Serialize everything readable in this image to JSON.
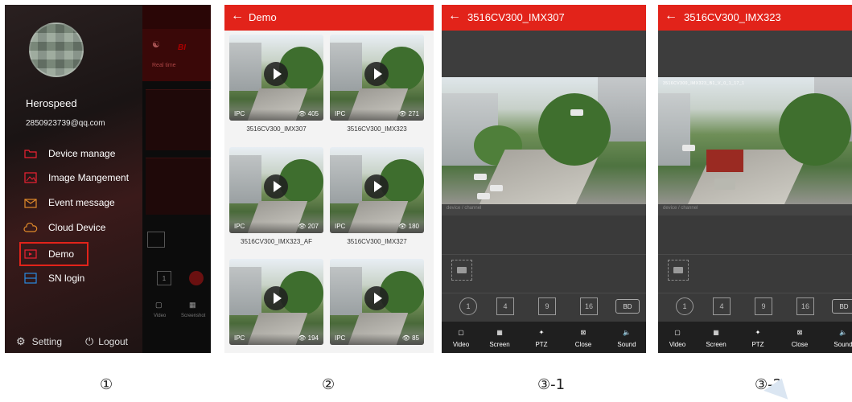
{
  "panel1": {
    "user_name": "Herospeed",
    "email": "2850923739@qq.com",
    "menu": [
      {
        "label": "Device manage",
        "icon": "folder-icon",
        "selected": false
      },
      {
        "label": "Image Mangement",
        "icon": "image-icon",
        "selected": false
      },
      {
        "label": "Event message",
        "icon": "envelope-icon",
        "selected": false
      },
      {
        "label": "Cloud Device",
        "icon": "cloud-icon",
        "selected": false
      },
      {
        "label": "Demo",
        "icon": "demo-icon",
        "selected": true
      },
      {
        "label": "SN login",
        "icon": "sn-icon",
        "selected": false
      }
    ],
    "setting_label": "Setting",
    "logout_label": "Logout",
    "bg_tab_label": "Real time",
    "bg_brand": "BI",
    "bg_video_label": "Video",
    "bg_screenshot_label": "Screenshot",
    "bg_view_index": "1"
  },
  "panel2": {
    "title": "Demo",
    "items": [
      {
        "name": "3516CV300_IMX307",
        "type": "IPC",
        "views": "405"
      },
      {
        "name": "3516CV300_IMX323",
        "type": "IPC",
        "views": "271"
      },
      {
        "name": "3516CV300_IMX323_AF",
        "type": "IPC",
        "views": "207"
      },
      {
        "name": "3516CV300_IMX327",
        "type": "IPC",
        "views": "180"
      },
      {
        "name": "",
        "type": "IPC",
        "views": "194"
      },
      {
        "name": "",
        "type": "IPC",
        "views": "85"
      }
    ]
  },
  "player1": {
    "title": "3516CV300_IMX307",
    "channel_label": "device / channel",
    "layouts": [
      "1",
      "4",
      "9",
      "16"
    ],
    "stream_label": "BD",
    "tools": [
      "Video",
      "Screen",
      "PTZ",
      "Close",
      "Sound"
    ]
  },
  "player2": {
    "title": "3516CV300_IMX323",
    "channel_label": "device / channel",
    "video_stamp": "3516CV300_IMX323_B1_V_0_1_17_1",
    "layouts": [
      "1",
      "4",
      "9",
      "16"
    ],
    "stream_label": "BD",
    "tools": [
      "Video",
      "Screen",
      "PTZ",
      "Close",
      "Sound"
    ]
  },
  "step_labels": [
    "①",
    "②",
    "③-1",
    "③-2"
  ],
  "colors": {
    "accent": "#e2231a",
    "player_bg": "#3a3a3a",
    "toolbar_bg": "#1f1f1f"
  }
}
